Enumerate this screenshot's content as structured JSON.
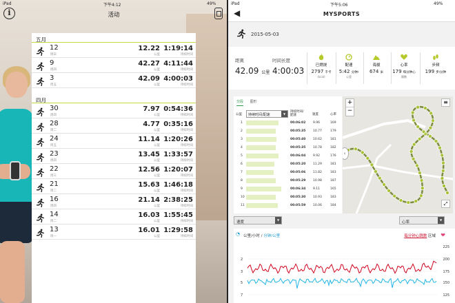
{
  "left": {
    "status": {
      "device": "iPad",
      "time": "下午4:12",
      "battery": "49%"
    },
    "title": "活动",
    "months": [
      {
        "label": "五月",
        "rows": [
          {
            "day": "12",
            "weekday": "周日",
            "distance": "12.22",
            "distance_unit": "公里",
            "time": "1:19:14",
            "time_unit": "持续时间"
          },
          {
            "day": "9",
            "weekday": "周四",
            "distance": "42.27",
            "distance_unit": "公里",
            "time": "4:11:44",
            "time_unit": "持续时间"
          },
          {
            "day": "3",
            "weekday": "周五",
            "distance": "42.09",
            "distance_unit": "公里",
            "time": "4:00:03",
            "time_unit": "持续时间"
          }
        ]
      },
      {
        "label": "四月",
        "rows": [
          {
            "day": "30",
            "weekday": "周四",
            "distance": "7.97",
            "distance_unit": "公里",
            "time": "0:54:36",
            "time_unit": "持续时间"
          },
          {
            "day": "28",
            "weekday": "周二",
            "distance": "4.77",
            "distance_unit": "公里",
            "time": "0:35:16",
            "time_unit": "持续时间"
          },
          {
            "day": "24",
            "weekday": "周五",
            "distance": "11.14",
            "distance_unit": "公里",
            "time": "1:20:26",
            "time_unit": "持续时间"
          },
          {
            "day": "23",
            "weekday": "周四",
            "distance": "13.45",
            "distance_unit": "公里",
            "time": "1:33:57",
            "time_unit": "持续时间"
          },
          {
            "day": "22",
            "weekday": "周三",
            "distance": "12.56",
            "distance_unit": "公里",
            "time": "1:20:07",
            "time_unit": "持续时间"
          },
          {
            "day": "21",
            "weekday": "周二",
            "distance": "15.63",
            "distance_unit": "公里",
            "time": "1:46:18",
            "time_unit": "持续时间"
          },
          {
            "day": "16",
            "weekday": "周四",
            "distance": "21.14",
            "distance_unit": "公里",
            "time": "2:38:25",
            "time_unit": "持续时间"
          },
          {
            "day": "14",
            "weekday": "周二",
            "distance": "16.03",
            "distance_unit": "公里",
            "time": "1:55:45",
            "time_unit": "持续时间"
          },
          {
            "day": "13",
            "weekday": "周一",
            "distance": "16.01",
            "distance_unit": "公里",
            "time": "1:29:58",
            "time_unit": "持续时间"
          }
        ]
      }
    ]
  },
  "right": {
    "status": {
      "device": "iPad",
      "time": "下午5:06",
      "battery": "49%"
    },
    "title": "MYSPORTS",
    "back": "◀",
    "date": "2015-05-03",
    "distance": {
      "label": "距离",
      "value": "42.09",
      "unit": "公里"
    },
    "duration": {
      "label": "时间长度",
      "value": "4:00:03"
    },
    "calories": {
      "label": "已燃烧",
      "value": "2797",
      "unit": "千卡",
      "note": "(kcal)"
    },
    "pace": {
      "label": "配速",
      "value": "5:42",
      "unit": "分钟/",
      "note": "公里"
    },
    "climb": {
      "label": "海拔",
      "value": "674",
      "unit": "米"
    },
    "heart": {
      "label": "心率",
      "value": "179",
      "unit": "每分钟心",
      "note": "跳数"
    },
    "steps": {
      "label": "步频",
      "value": "199",
      "unit": "步/分钟"
    },
    "tabs": [
      "分段",
      "图形"
    ],
    "table": {
      "col1": "公里",
      "select": "持续时间/配速",
      "col3": "持续时间/配速",
      "col4": "速度",
      "col5": "心率",
      "rows": [
        {
          "km": "1",
          "time": "00:06:02",
          "speed": "9.96",
          "hr": "169",
          "pace_fraction": 0.78
        },
        {
          "km": "2",
          "time": "00:05:35",
          "speed": "10.77",
          "hr": "179",
          "pace_fraction": 0.72
        },
        {
          "km": "3",
          "time": "00:05:40",
          "speed": "10.62",
          "hr": "181",
          "pace_fraction": 0.73
        },
        {
          "km": "4",
          "time": "00:05:35",
          "speed": "10.78",
          "hr": "182",
          "pace_fraction": 0.72
        },
        {
          "km": "5",
          "time": "00:06:04",
          "speed": "9.92",
          "hr": "176",
          "pace_fraction": 0.78
        },
        {
          "km": "6",
          "time": "00:05:20",
          "speed": "11.29",
          "hr": "181",
          "pace_fraction": 0.69
        },
        {
          "km": "7",
          "time": "00:05:06",
          "speed": "11.82",
          "hr": "183",
          "pace_fraction": 0.66
        },
        {
          "km": "8",
          "time": "00:05:29",
          "speed": "10.98",
          "hr": "187",
          "pace_fraction": 0.71
        },
        {
          "km": "9",
          "time": "00:06:34",
          "speed": "9.11",
          "hr": "165",
          "pace_fraction": 0.85
        },
        {
          "km": "10",
          "time": "00:05:30",
          "speed": "10.93",
          "hr": "183",
          "pace_fraction": 0.71
        },
        {
          "km": "11",
          "time": "00:05:59",
          "speed": "10.06",
          "hr": "184",
          "pace_fraction": 0.77
        }
      ]
    },
    "chart_select_left": "速度",
    "chart_select_right": "心率",
    "chart": {
      "left_label_a": "公里/小时",
      "left_label_b": "分钟/公里",
      "right_label": "每分钟心跳数",
      "right_suffix": "区域",
      "left_ticks": [
        "2",
        "3",
        "5",
        "7"
      ],
      "right_ticks": [
        "225",
        "200",
        "175",
        "150",
        "125"
      ]
    },
    "colors": {
      "accent": "#c7d949",
      "heart_line": "#d0021b",
      "speed_line": "#21b5e6"
    }
  }
}
